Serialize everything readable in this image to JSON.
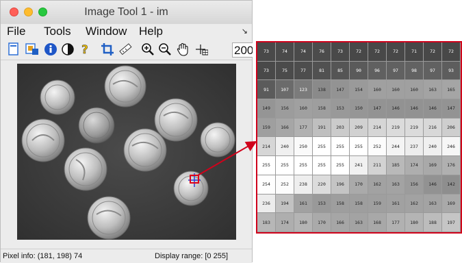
{
  "window": {
    "title": "Image Tool 1 - im",
    "menus": [
      "File",
      "Tools",
      "Window",
      "Help"
    ],
    "zoom_value": "200",
    "status": {
      "pixel_info": "Pixel info: (181, 198)  74",
      "display_range": "Display range: [0 255]"
    },
    "toolbar_icons": [
      "new-figure-icon",
      "image-info-icon",
      "info-icon",
      "contrast-icon",
      "help-icon",
      "crop-icon",
      "measure-distance-icon",
      "zoom-in-icon",
      "zoom-out-icon",
      "pan-hand-icon",
      "pixel-region-icon"
    ]
  },
  "pixel_region": {
    "values": [
      [
        73,
        74,
        74,
        76,
        73,
        72,
        72,
        72,
        71,
        72,
        72
      ],
      [
        73,
        75,
        77,
        81,
        85,
        90,
        96,
        97,
        98,
        97,
        93
      ],
      [
        91,
        107,
        123,
        138,
        147,
        154,
        160,
        160,
        160,
        163,
        165
      ],
      [
        149,
        156,
        160,
        158,
        153,
        150,
        147,
        146,
        146,
        146,
        147
      ],
      [
        159,
        166,
        177,
        191,
        203,
        209,
        214,
        219,
        219,
        216,
        206
      ],
      [
        214,
        240,
        250,
        255,
        255,
        255,
        252,
        244,
        237,
        240,
        246
      ],
      [
        255,
        255,
        255,
        255,
        255,
        241,
        211,
        185,
        174,
        169,
        176
      ],
      [
        254,
        252,
        238,
        220,
        196,
        170,
        162,
        163,
        156,
        146,
        142
      ],
      [
        236,
        194,
        161,
        153,
        158,
        158,
        159,
        161,
        162,
        163,
        169
      ],
      [
        183,
        174,
        180,
        170,
        166,
        163,
        168,
        177,
        180,
        188,
        197
      ]
    ],
    "highlight_color": "#d0021b"
  }
}
